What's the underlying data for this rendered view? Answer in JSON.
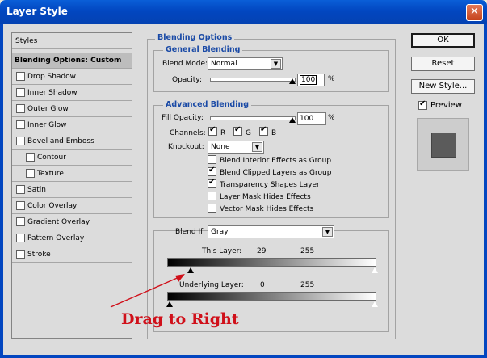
{
  "window": {
    "title": "Layer Style",
    "close_glyph": "✕"
  },
  "styles_list": {
    "header": "Styles",
    "selected": "Blending Options: Custom",
    "items": [
      {
        "label": "Drop Shadow",
        "checked": false,
        "indent": false
      },
      {
        "label": "Inner Shadow",
        "checked": false,
        "indent": false
      },
      {
        "label": "Outer Glow",
        "checked": false,
        "indent": false
      },
      {
        "label": "Inner Glow",
        "checked": false,
        "indent": false
      },
      {
        "label": "Bevel and Emboss",
        "checked": false,
        "indent": false
      },
      {
        "label": "Contour",
        "checked": false,
        "indent": true
      },
      {
        "label": "Texture",
        "checked": false,
        "indent": true
      },
      {
        "label": "Satin",
        "checked": false,
        "indent": false
      },
      {
        "label": "Color Overlay",
        "checked": false,
        "indent": false
      },
      {
        "label": "Gradient Overlay",
        "checked": false,
        "indent": false
      },
      {
        "label": "Pattern Overlay",
        "checked": false,
        "indent": false
      },
      {
        "label": "Stroke",
        "checked": false,
        "indent": false
      }
    ]
  },
  "blending_options": {
    "title": "Blending Options",
    "general": {
      "title": "General Blending",
      "blend_mode_label": "Blend Mode:",
      "blend_mode_value": "Normal",
      "opacity_label": "Opacity:",
      "opacity_value": "100",
      "opacity_unit": "%",
      "opacity_level": 1.0
    },
    "advanced": {
      "title": "Advanced Blending",
      "fill_opacity_label": "Fill Opacity:",
      "fill_opacity_value": "100",
      "fill_opacity_unit": "%",
      "fill_opacity_level": 1.0,
      "channels_label": "Channels:",
      "channels": [
        {
          "label": "R",
          "checked": true
        },
        {
          "label": "G",
          "checked": true
        },
        {
          "label": "B",
          "checked": true
        }
      ],
      "knockout_label": "Knockout:",
      "knockout_value": "None",
      "options": [
        {
          "label": "Blend Interior Effects as Group",
          "checked": false
        },
        {
          "label": "Blend Clipped Layers as Group",
          "checked": true
        },
        {
          "label": "Transparency Shapes Layer",
          "checked": true
        },
        {
          "label": "Layer Mask Hides Effects",
          "checked": false
        },
        {
          "label": "Vector Mask Hides Effects",
          "checked": false
        }
      ]
    },
    "blend_if": {
      "label": "Blend If:",
      "value": "Gray",
      "this_layer_label": "This Layer:",
      "this_layer_low": "29",
      "this_layer_high": "255",
      "this_layer_low_level": 0.114,
      "underlying_label": "Underlying Layer:",
      "underlying_low": "0",
      "underlying_high": "255",
      "underlying_low_level": 0.0
    }
  },
  "buttons": {
    "ok": "OK",
    "reset": "Reset",
    "new_style": "New Style...",
    "preview": "Preview",
    "preview_checked": true
  },
  "annotation": {
    "text": "Drag to Right",
    "color": "#d0101a"
  }
}
